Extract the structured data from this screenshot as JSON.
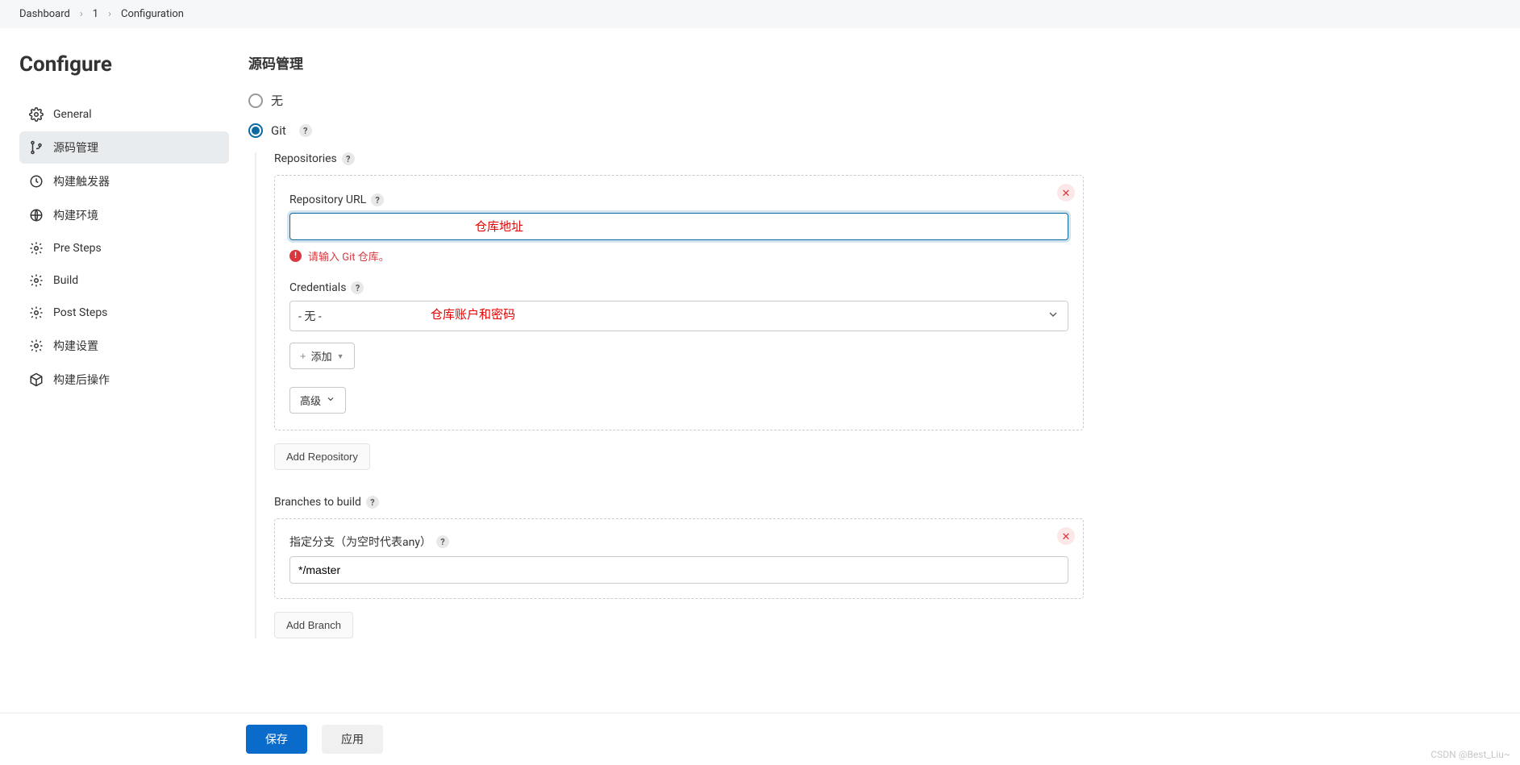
{
  "breadcrumb": {
    "items": [
      "Dashboard",
      "1",
      "Configuration"
    ]
  },
  "sidebar": {
    "title": "Configure",
    "items": [
      {
        "label": "General"
      },
      {
        "label": "源码管理"
      },
      {
        "label": "构建触发器"
      },
      {
        "label": "构建环境"
      },
      {
        "label": "Pre Steps"
      },
      {
        "label": "Build"
      },
      {
        "label": "Post Steps"
      },
      {
        "label": "构建设置"
      },
      {
        "label": "构建后操作"
      }
    ]
  },
  "main": {
    "section_title": "源码管理",
    "radio_none": "无",
    "radio_git": "Git",
    "repositories_label": "Repositories",
    "repo": {
      "url_label": "Repository URL",
      "url_value": "",
      "url_annotation": "仓库地址",
      "error_text": "请输入 Git 仓库。",
      "credentials_label": "Credentials",
      "credentials_value": "- 无 -",
      "credentials_annotation": "仓库账户和密码",
      "add_button": "添加",
      "advanced_button": "高级"
    },
    "add_repository": "Add Repository",
    "branches_label": "Branches to build",
    "branch": {
      "label": "指定分支（为空时代表any）",
      "value": "*/master"
    },
    "add_branch": "Add Branch"
  },
  "footer": {
    "save": "保存",
    "apply": "应用"
  },
  "watermark": "CSDN @Best_Liu~"
}
